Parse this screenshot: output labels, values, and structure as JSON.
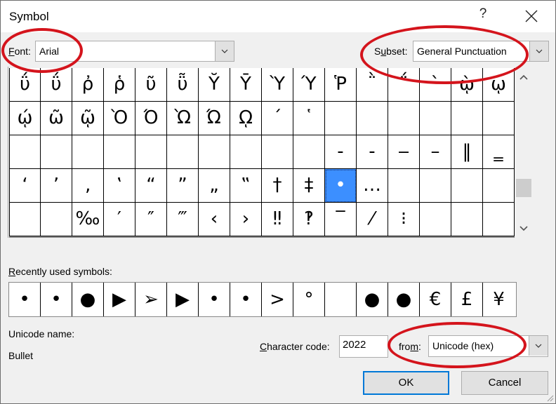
{
  "window": {
    "title": "Symbol",
    "help_label": "?",
    "close_icon": "close-icon"
  },
  "font": {
    "label_prefix": "",
    "label_accel": "F",
    "label_rest": "ont:",
    "value": "Arial"
  },
  "subset": {
    "label_prefix": "S",
    "label_accel": "u",
    "label_rest": "bset:",
    "value": "General Punctuation"
  },
  "symbol_grid": {
    "selected": "•",
    "rows": [
      [
        "ΰ",
        "ΰ",
        "ῤ",
        "ῥ",
        "ῦ",
        "ῧ",
        "Ῠ",
        "Ῡ",
        "Ὺ",
        "Ύ",
        "Ῥ",
        "῭",
        "΅",
        "`",
        "ῲ",
        "ῳ"
      ],
      [
        "ῴ",
        "ῶ",
        "ῷ",
        "Ὸ",
        "Ό",
        "Ὼ",
        "Ώ",
        "ῼ",
        "´",
        "῾",
        "",
        "",
        "",
        "",
        "",
        ""
      ],
      [
        "",
        "",
        "",
        "",
        "",
        "",
        "",
        "",
        "",
        "",
        "‐",
        "‑",
        "‒",
        "–",
        "‖",
        "‗"
      ],
      [
        "‘",
        "’",
        "‚",
        "‛",
        "“",
        "”",
        "„",
        "‟",
        "†",
        "‡",
        "•",
        "…",
        "",
        "",
        "",
        ""
      ],
      [
        "",
        "",
        "‰",
        "′",
        "″",
        "‴",
        "‹",
        "›",
        "‼",
        "‽",
        "‾",
        "⁄",
        "⁝",
        "",
        "",
        ""
      ]
    ]
  },
  "recent": {
    "label_accel": "R",
    "label_rest": "ecently used symbols:",
    "symbols": [
      "•",
      "•",
      "●",
      "▶",
      "➢",
      "▶",
      "•",
      "•",
      ">",
      "°",
      "",
      "●",
      "●",
      "€",
      "£",
      "¥"
    ]
  },
  "unicode_name": {
    "label": "Unicode name:",
    "value": "Bullet"
  },
  "char_code": {
    "label_accel": "C",
    "label_rest": "haracter code:",
    "value": "2022"
  },
  "from": {
    "label_prefix": "fro",
    "label_accel": "m",
    "label_rest": ":",
    "value": "Unicode (hex)"
  },
  "buttons": {
    "ok": "OK",
    "cancel": "Cancel"
  },
  "annotation_color": "#d4141c",
  "selection_color": "#3c8fff"
}
